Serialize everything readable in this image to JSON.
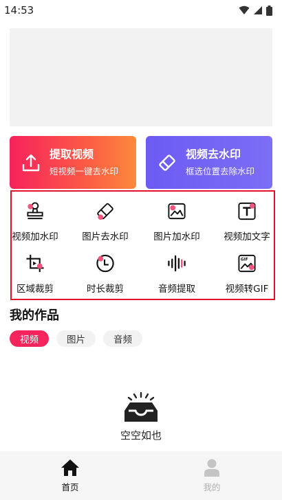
{
  "status_bar": {
    "time": "14:53"
  },
  "cards": [
    {
      "title": "提取视频",
      "subtitle": "短视频一键去水印",
      "icon": "upload-tray-icon"
    },
    {
      "title": "视频去水印",
      "subtitle": "框选位置去除水印",
      "icon": "eraser-icon"
    }
  ],
  "tools": [
    {
      "label": "视频加水印",
      "icon": "stamp-icon"
    },
    {
      "label": "图片去水印",
      "icon": "eraser-icon"
    },
    {
      "label": "图片加水印",
      "icon": "image-icon"
    },
    {
      "label": "视频加文字",
      "icon": "text-icon"
    },
    {
      "label": "区域裁剪",
      "icon": "crop-icon"
    },
    {
      "label": "时长裁剪",
      "icon": "clock-icon"
    },
    {
      "label": "音频提取",
      "icon": "audio-wave-icon"
    },
    {
      "label": "视频转GIF",
      "icon": "gif-icon"
    }
  ],
  "works": {
    "title": "我的作品",
    "tabs": [
      "视频",
      "图片",
      "音频"
    ],
    "active_tab": "视频",
    "empty_text": "空空如也"
  },
  "bottom_nav": [
    {
      "label": "首页",
      "icon": "home-icon",
      "active": true
    },
    {
      "label": "我的",
      "icon": "user-icon",
      "active": false
    }
  ],
  "colors": {
    "accent": "#f6245c",
    "purple": "#6c5bf3",
    "highlight_border": "#e4102b",
    "dot": "#f2547e"
  }
}
